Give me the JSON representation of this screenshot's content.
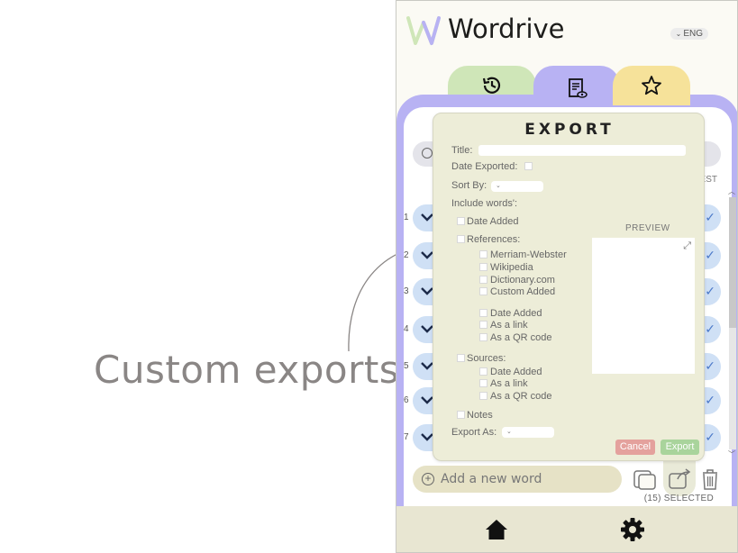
{
  "callout": {
    "text": "Custom exports"
  },
  "app": {
    "title": "Wordrive",
    "language": "ENG"
  },
  "tabs": [
    {
      "name": "history",
      "icon": "history-icon"
    },
    {
      "name": "word-list",
      "icon": "document-eye-icon"
    },
    {
      "name": "favorites",
      "icon": "star-icon"
    }
  ],
  "list": {
    "sort_label": "EST",
    "row_numbers": [
      "1",
      "2",
      "3",
      "4",
      "5",
      "6",
      "7"
    ]
  },
  "bottom_toolbar": {
    "add_word_placeholder": "Add a new word",
    "selected_count": "(15) SELECTED"
  },
  "export_dialog": {
    "title": "EXPORT",
    "title_label": "Title:",
    "date_exported_label": "Date Exported:",
    "sort_by_label": "Sort By:",
    "include_words_label": "Include words':",
    "date_added": "Date Added",
    "references": "References:",
    "ref_sources": [
      "Merriam-Webster",
      "Wikipedia",
      "Dictionary.com",
      "Custom Added"
    ],
    "ref_options": [
      "Date Added",
      "As a link",
      "As a QR code"
    ],
    "sources": "Sources:",
    "source_options": [
      "Date Added",
      "As a link",
      "As a QR code"
    ],
    "notes": "Notes",
    "export_as_label": "Export As:",
    "preview_label": "PREVIEW",
    "cancel_label": "Cancel",
    "export_label": "Export"
  },
  "colors": {
    "history_tab": "#cfe6b8",
    "list_tab": "#b8b2f3",
    "favorites_tab": "#f6e29a",
    "row_bg": "#cfe0f5",
    "dialog_bg": "#ededd8",
    "cancel": "#e4a19d",
    "export": "#a9d49c"
  }
}
